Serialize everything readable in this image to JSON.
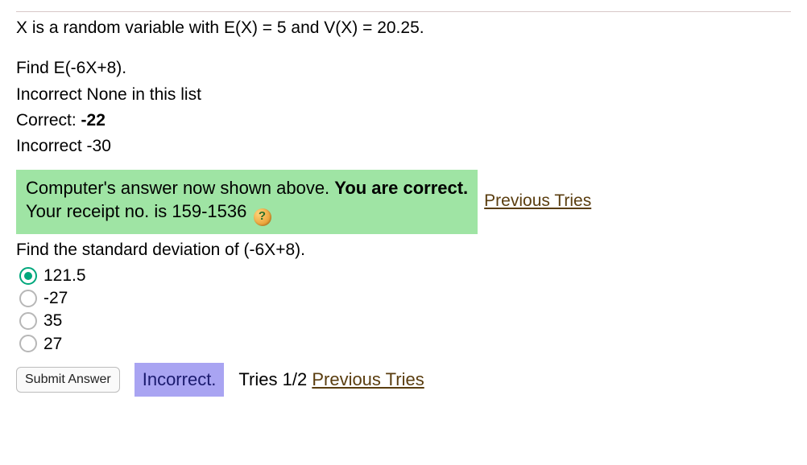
{
  "problem": {
    "premise": "X is a random variable with E(X) = 5 and V(X) = 20.25.",
    "part1": {
      "prompt": "Find E(-6X+8).",
      "feedback_lines": [
        {
          "prefix": "Incorrect ",
          "value": "None in this list"
        },
        {
          "prefix": "Correct: ",
          "value": "-22",
          "bold_value": true
        },
        {
          "prefix": "Incorrect ",
          "value": "-30"
        }
      ]
    },
    "correct_box": {
      "line1_a": "Computer's answer now shown above. ",
      "line1_b": "You are correct.",
      "line2": "Your receipt no. is 159-1536"
    },
    "previous_tries_label": "Previous Tries",
    "part2": {
      "prompt": "Find the standard deviation of (-6X+8).",
      "options": [
        "121.5",
        "-27",
        "35",
        "27"
      ],
      "selected_index": 0
    },
    "footer": {
      "submit_label": "Submit Answer",
      "status": "Incorrect.",
      "tries_text": "Tries 1/2",
      "previous_tries_label": "Previous Tries"
    }
  }
}
